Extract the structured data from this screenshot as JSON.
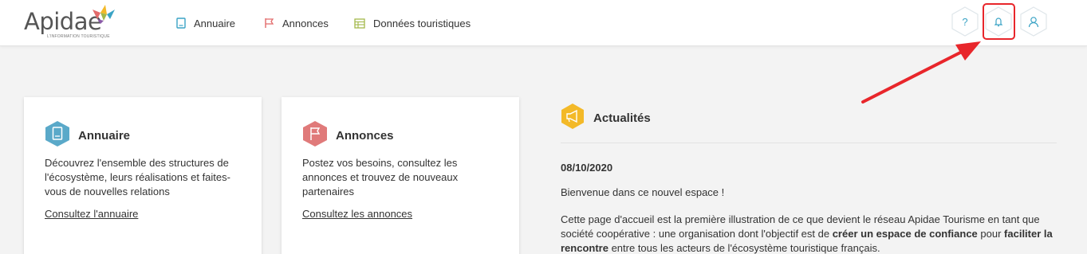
{
  "header": {
    "logo": {
      "wordmark": "Apidae",
      "tagline": "L'INFORMATION TOURISTIQUE"
    },
    "nav": [
      {
        "label": "Annuaire",
        "icon": "book-icon",
        "color": "#3aa3c5"
      },
      {
        "label": "Annonces",
        "icon": "flag-icon",
        "color": "#e26a6a"
      },
      {
        "label": "Données touristiques",
        "icon": "table-icon",
        "color": "#a3b84a"
      }
    ],
    "actions": {
      "help_label": "?",
      "notifications_icon": "bell-icon",
      "profile_icon": "user-icon"
    }
  },
  "cards": [
    {
      "title": "Annuaire",
      "icon": "book-icon",
      "icon_color": "#5aa9c9",
      "description": "Découvrez l'ensemble des structures de l'écosystème, leurs réalisations et faites-vous de nouvelles relations",
      "link": "Consultez l'annuaire"
    },
    {
      "title": "Annonces",
      "icon": "flag-icon",
      "icon_color": "#e07a7a",
      "description": "Postez vos besoins, consultez les annonces et trouvez de nouveaux partenaires",
      "link": "Consultez les annonces"
    }
  ],
  "news": {
    "title": "Actualités",
    "icon": "megaphone-icon",
    "icon_color": "#f3b928",
    "date": "08/10/2020",
    "welcome": "Bienvenue dans ce nouvel espace !",
    "body_part1": "Cette page d'accueil est la première illustration de ce que devient le réseau Apidae Tourisme en tant que société coopérative : une organisation dont l'objectif est de ",
    "body_bold1": "créer un espace de confiance",
    "body_part2": " pour ",
    "body_bold2": "faciliter la rencontre",
    "body_part3": " entre tous les acteurs de l'écosystème touristique français."
  },
  "annotation": {
    "highlight_color": "#e8262b"
  }
}
